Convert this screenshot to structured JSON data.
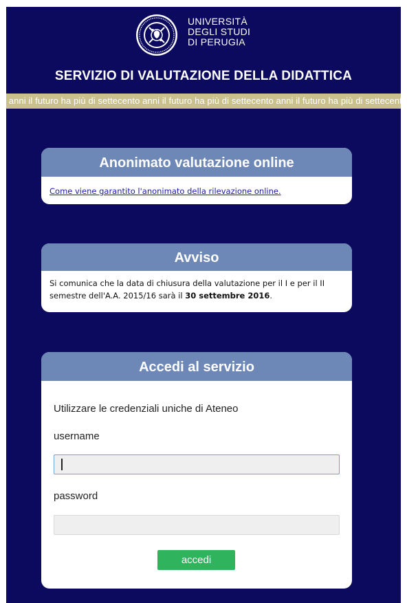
{
  "header": {
    "university_lines": [
      "UNIVERSITÀ",
      "DEGLI STUDI",
      "DI PERUGIA"
    ],
    "logo_icon": "university-seal-icon",
    "service_title": "SERVIZIO DI VALUTAZIONE DELLA DIDATTICA",
    "marquee_text": "ito anni il futuro ha più di settecento anni il futuro ha più di settecento anni il futuro ha più di settecento anni il fu"
  },
  "anonimato": {
    "title": "Anonimato valutazione online",
    "link_text": "Come viene garantito l'anonimato della rilevazione online."
  },
  "avviso": {
    "title": "Avviso",
    "text_before": "Si comunica che la data di chiusura della valutazione per il I e per il II semestre dell'A.A. 2015/16 sarà il ",
    "text_bold": "30 settembre 2016",
    "text_after": "."
  },
  "login": {
    "title": "Accedi al servizio",
    "intro": "Utilizzare le credenziali uniche di Ateneo",
    "username_label": "username",
    "username_value": "",
    "password_label": "password",
    "password_value": "",
    "submit_label": "accedi"
  },
  "colors": {
    "background": "#0b0a5e",
    "card_header": "#6d88b6",
    "marquee": "#c9c08c",
    "button": "#2fb45d"
  }
}
